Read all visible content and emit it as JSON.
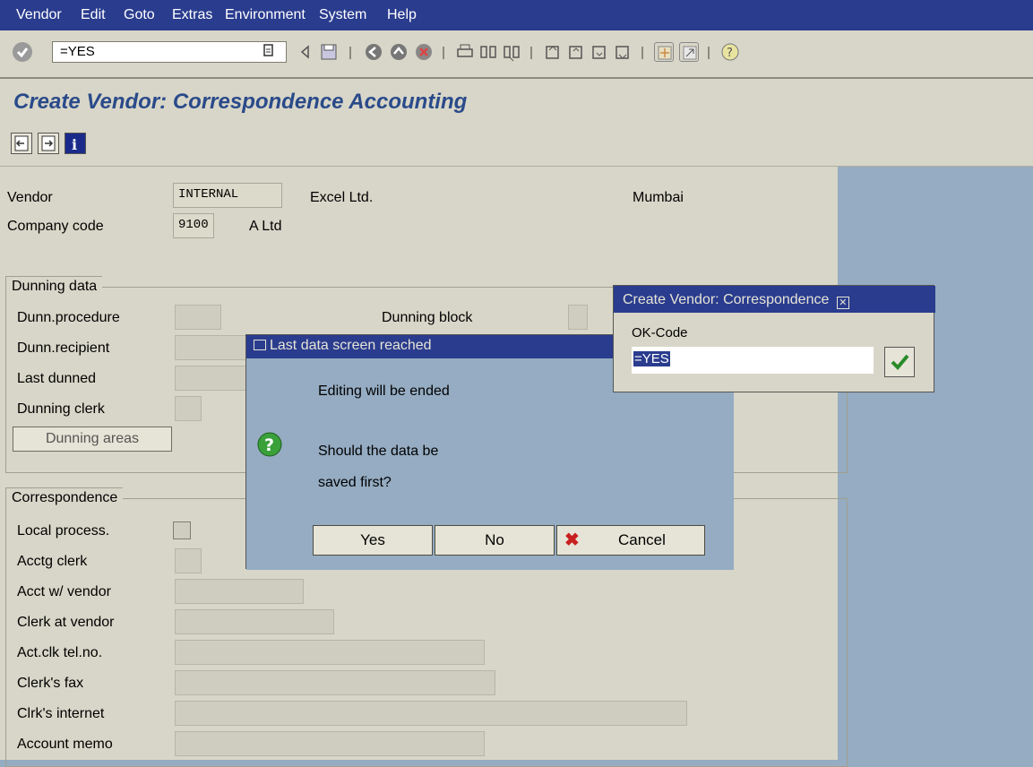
{
  "menu": {
    "items": [
      {
        "label": "Vendor",
        "underline": "V"
      },
      {
        "label": "Edit",
        "underline": "E"
      },
      {
        "label": "Goto",
        "underline": "G"
      },
      {
        "label": "Extras",
        "underline": "x"
      },
      {
        "label": "Environment",
        "underline": "n"
      },
      {
        "label": "System",
        "underline": "y"
      },
      {
        "label": "Help",
        "underline": "H"
      }
    ]
  },
  "toolbar": {
    "command_value": "=YES",
    "icons": [
      "enter-icon",
      "back-icon",
      "exit-icon",
      "cancel-icon",
      "print-icon",
      "find-icon",
      "find-next-icon",
      "first-page-icon",
      "prev-page-icon",
      "next-page-icon",
      "last-page-icon",
      "new-session-icon",
      "shortcut-icon",
      "help-icon"
    ]
  },
  "page": {
    "title": "Create Vendor: Correspondence Accounting"
  },
  "app_toolbar": {
    "icons": [
      "prev-screen-icon",
      "next-screen-icon",
      "info-icon"
    ]
  },
  "header": {
    "vendor_label": "Vendor",
    "vendor_value": "INTERNAL",
    "vendor_name": "Excel Ltd.",
    "vendor_city": "Mumbai",
    "company_code_label": "Company code",
    "company_code_value": "9100",
    "company_name": "A Ltd"
  },
  "dunning": {
    "tab_label": "Dunning data",
    "procedure_label": "Dunn.procedure",
    "block_label": "Dunning block",
    "recipient_label": "Dunn.recipient",
    "last_dunned_label": "Last dunned",
    "clerk_label": "Dunning clerk",
    "areas_button": "Dunning areas"
  },
  "correspondence": {
    "tab_label": "Correspondence",
    "local_process_label": "Local process.",
    "acctg_clerk_label": "Acctg clerk",
    "acct_vendor_label": "Acct w/ vendor",
    "clerk_vendor_label": "Clerk at vendor",
    "tel_label": "Act.clk tel.no.",
    "fax_label": "Clerk's fax",
    "internet_label": "Clrk's internet",
    "memo_label": "Account memo"
  },
  "popup_save": {
    "title": "Last data screen reached",
    "line1": "Editing will be ended",
    "line2": "Should the data be",
    "line3": "saved first?",
    "yes": "Yes",
    "no": "No",
    "cancel": "Cancel"
  },
  "popup_okcode": {
    "title": "Create Vendor: Correspondence",
    "label": "OK-Code",
    "value": "=YES"
  },
  "colors": {
    "menubar": "#2a3c8e",
    "panel": "#d8d6c8",
    "background": "#95acc2",
    "title": "#2a4a8a"
  }
}
